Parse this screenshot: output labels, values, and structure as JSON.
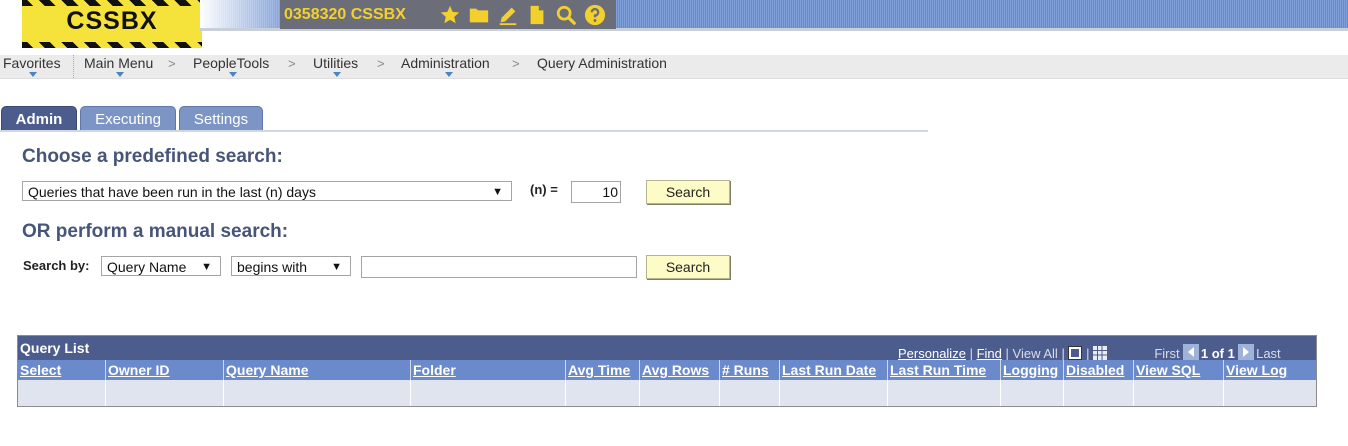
{
  "header": {
    "logo_text": "CSSBX",
    "system_label": "0358320 CSSBX",
    "icons": [
      "star-icon",
      "folder-icon",
      "pencil-icon",
      "page-icon",
      "search-icon",
      "help-icon"
    ],
    "accent_color": "#f3d02b"
  },
  "nav": {
    "items": [
      "Favorites",
      "Main Menu",
      "PeopleTools",
      "Utilities",
      "Administration",
      "Query Administration"
    ],
    "separator": ">"
  },
  "tabs": {
    "admin": "Admin",
    "executing": "Executing",
    "settings": "Settings",
    "active": "Admin"
  },
  "predefined": {
    "heading": "Choose a predefined search:",
    "selected": "Queries that have been run in the last (n) days",
    "n_label": "(n) =",
    "n_value": "10",
    "button": "Search"
  },
  "manual": {
    "heading": "OR perform a manual search:",
    "search_by_label": "Search by:",
    "field": "Query Name",
    "operator": "begins with",
    "value": "",
    "button": "Search"
  },
  "grid": {
    "title": "Query List",
    "personalize": "Personalize",
    "find": "Find",
    "view_all": "View All",
    "first": "First",
    "count": "1 of 1",
    "last": "Last",
    "columns": [
      "Select",
      "Owner ID",
      "Query Name",
      "Folder",
      "Avg Time",
      "Avg Rows",
      "# Runs",
      "Last Run Date",
      "Last Run Time",
      "Logging",
      "Disabled",
      "View SQL",
      "View Log"
    ]
  }
}
